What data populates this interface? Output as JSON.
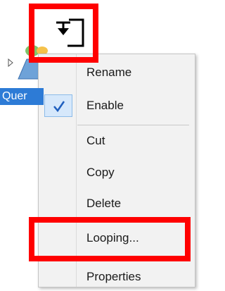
{
  "tree": {
    "node_label": "Quer"
  },
  "context_menu": {
    "items": [
      {
        "label": "Rename"
      },
      {
        "label": "Enable",
        "checked": true
      },
      {
        "label": "Cut"
      },
      {
        "label": "Copy"
      },
      {
        "label": "Delete"
      },
      {
        "label": "Looping..."
      },
      {
        "label": "Properties"
      }
    ]
  },
  "highlight": {
    "color": "#ff0000",
    "targets": [
      "pointer-icon",
      "menu-item-looping"
    ]
  },
  "colors": {
    "selection_blue": "#2d7bd6",
    "menu_background": "#f2f2f2",
    "check_background": "#d6e8fb"
  },
  "icons": [
    "pointer-icon",
    "query-icon",
    "expand-arrow-icon",
    "checkmark-icon"
  ]
}
